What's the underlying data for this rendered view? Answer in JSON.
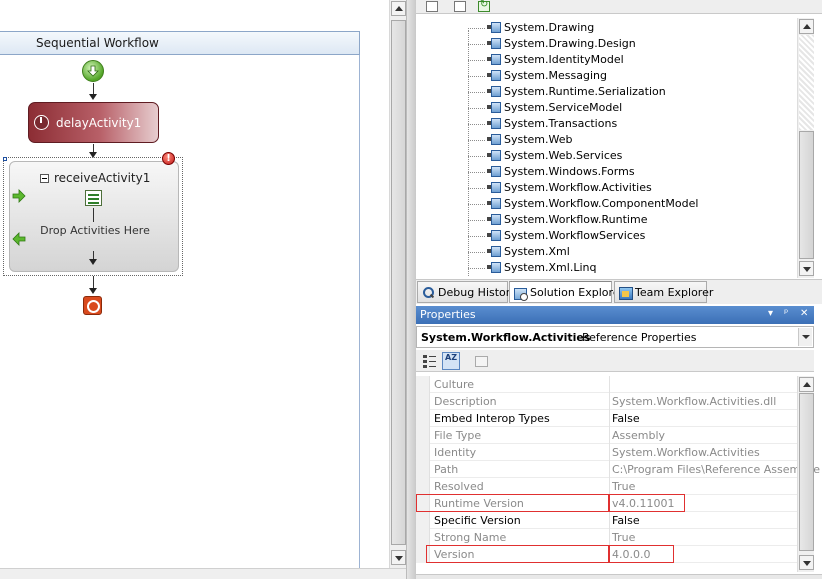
{
  "designer": {
    "title": "Sequential Workflow",
    "delay_activity": "delayActivity1",
    "receive_activity": "receiveActivity1",
    "drop_hint": "Drop Activities Here"
  },
  "solution_explorer": {
    "references": [
      "System.Drawing",
      "System.Drawing.Design",
      "System.IdentityModel",
      "System.Messaging",
      "System.Runtime.Serialization",
      "System.ServiceModel",
      "System.Transactions",
      "System.Web",
      "System.Web.Services",
      "System.Windows.Forms",
      "System.Workflow.Activities",
      "System.Workflow.ComponentModel",
      "System.Workflow.Runtime",
      "System.WorkflowServices",
      "System.Xml",
      "System.Xml.Linq"
    ],
    "tabs": [
      {
        "label": "Debug History",
        "icon": "magnify-icon"
      },
      {
        "label": "Solution Explorer",
        "icon": "solution-icon"
      },
      {
        "label": "Team Explorer",
        "icon": "team-icon"
      }
    ],
    "active_tab": "Solution Explorer"
  },
  "properties": {
    "title": "Properties",
    "title_controls": [
      "▾",
      "ᵖ",
      "✕"
    ],
    "object_name": "System.Workflow.Activities",
    "object_type": "Reference Properties",
    "rows": [
      {
        "name": "Culture",
        "value": "",
        "readonly": true
      },
      {
        "name": "Description",
        "value": "System.Workflow.Activities.dll",
        "readonly": true
      },
      {
        "name": "Embed Interop Types",
        "value": "False",
        "readonly": false
      },
      {
        "name": "File Type",
        "value": "Assembly",
        "readonly": true
      },
      {
        "name": "Identity",
        "value": "System.Workflow.Activities",
        "readonly": true
      },
      {
        "name": "Path",
        "value": "C:\\Program Files\\Reference Assemblie",
        "readonly": true
      },
      {
        "name": "Resolved",
        "value": "True",
        "readonly": true
      },
      {
        "name": "Runtime Version",
        "value": "v4.0.11001",
        "readonly": true
      },
      {
        "name": "Specific Version",
        "value": "False",
        "readonly": false
      },
      {
        "name": "Strong Name",
        "value": "True",
        "readonly": true
      },
      {
        "name": "Version",
        "value": "4.0.0.0",
        "readonly": true
      }
    ],
    "highlighted_rows": [
      "Runtime Version",
      "Version"
    ]
  },
  "colors": {
    "titlebar": "#3b6fb6",
    "delay_activity": "#8c2d34",
    "highlight": "#e03030"
  }
}
